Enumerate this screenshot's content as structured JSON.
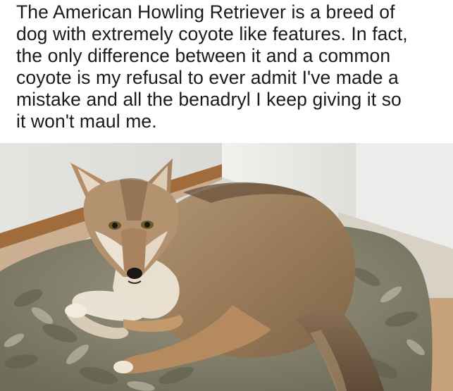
{
  "caption": {
    "lines": [
      "The American Howling Retriever is a breed of",
      "dog with extremely coyote like features. In fact,",
      "the only difference between it and a common",
      "coyote is my refusal to ever admit I've made a",
      "mistake and all the benadryl I keep giving it so",
      "it won't maul me."
    ]
  },
  "photo": {
    "subject_icon": "coyote-lying-on-dog-bed"
  },
  "colors": {
    "background": "#ffffff",
    "text": "#1a1a1a",
    "wall": "#dcdcd8",
    "baseboard": "#9a6a3e",
    "bed": "#8e8a74",
    "coat": "#a08462",
    "coat_light": "#e6dccb"
  }
}
